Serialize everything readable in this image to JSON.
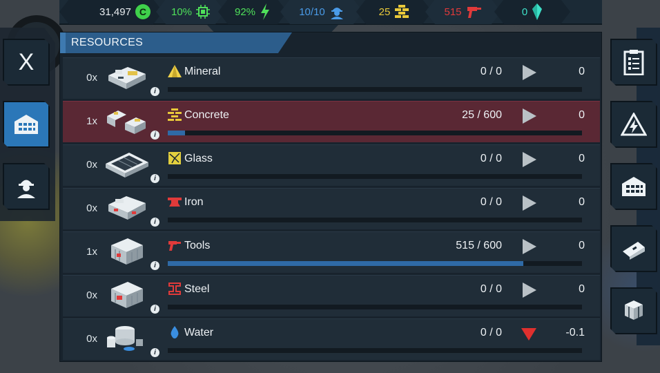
{
  "topbar": {
    "credits": "31,497",
    "credit_symbol": "C",
    "chips": "10%",
    "energy": "92%",
    "workers": "10/10",
    "concrete": "25",
    "tools": "515",
    "crystals": "0"
  },
  "panel": {
    "title": "RESOURCES"
  },
  "close_label": "X",
  "info_glyph": "i",
  "resources": [
    {
      "count": "0x",
      "name": "Mineral",
      "amount": "0 / 0",
      "rate": "0",
      "fill": 0,
      "trend": "up",
      "icon": "mineral-icon",
      "color": "#f0d24a"
    },
    {
      "count": "1x",
      "name": "Concrete",
      "amount": "25 / 600",
      "rate": "0",
      "fill": 0.042,
      "trend": "up",
      "icon": "concrete-icon",
      "color": "#e9c93a"
    },
    {
      "count": "0x",
      "name": "Glass",
      "amount": "0 / 0",
      "rate": "0",
      "fill": 0,
      "trend": "up",
      "icon": "glass-icon",
      "color": "#e3d03e"
    },
    {
      "count": "0x",
      "name": "Iron",
      "amount": "0 / 0",
      "rate": "0",
      "fill": 0,
      "trend": "up",
      "icon": "iron-icon",
      "color": "#e03a3a"
    },
    {
      "count": "1x",
      "name": "Tools",
      "amount": "515 / 600",
      "rate": "0",
      "fill": 0.858,
      "trend": "up",
      "icon": "tools-icon",
      "color": "#e03a3a"
    },
    {
      "count": "0x",
      "name": "Steel",
      "amount": "0 / 0",
      "rate": "0",
      "fill": 0,
      "trend": "up",
      "icon": "steel-icon",
      "color": "#e03a3a"
    },
    {
      "count": "0x",
      "name": "Water",
      "amount": "0 / 0",
      "rate": "-0.1",
      "fill": 0,
      "trend": "down",
      "icon": "water-icon",
      "color": "#3a8ee0"
    }
  ]
}
